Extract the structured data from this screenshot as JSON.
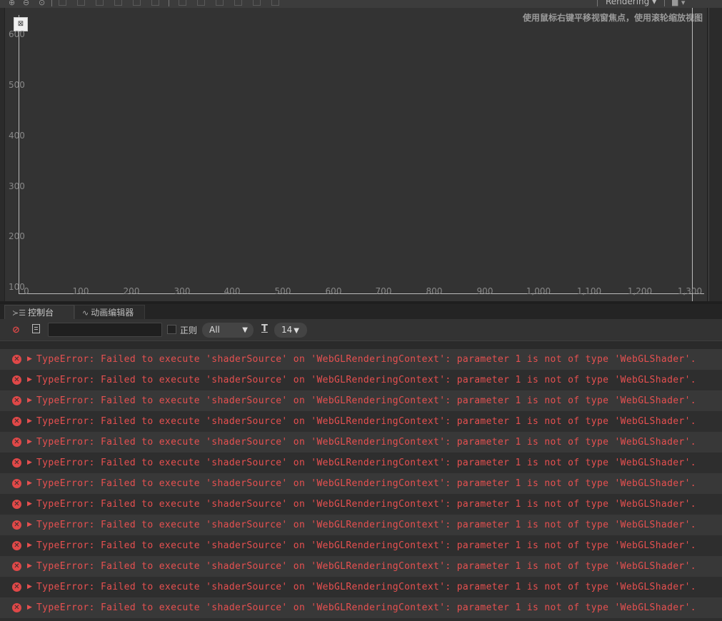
{
  "toolbar": {
    "render_mode": "Rendering",
    "render_mode_arrow": "▾",
    "camera_arrow": "▾",
    "icons": [
      "zoom-in-icon",
      "zoom-out-icon",
      "zoom-fit-icon",
      "align-left-icon",
      "align-center-h-icon",
      "align-right-icon",
      "align-top-icon",
      "align-center-v-icon",
      "align-bottom-icon",
      "distribute-h-icon",
      "distribute-v-icon",
      "camera-icon"
    ]
  },
  "scene": {
    "hint": "使用鼠标右键平移视窗焦点，使用滚轮缩放视图",
    "y_ticks": [
      "600",
      "500",
      "400",
      "300",
      "200",
      "100"
    ],
    "x_ticks": [
      "0",
      "100",
      "200",
      "300",
      "400",
      "500",
      "600",
      "700",
      "800",
      "900",
      "1,000",
      "1,100",
      "1,200",
      "1,300"
    ]
  },
  "tabs": {
    "console": "控制台",
    "animation": "动画编辑器"
  },
  "console_toolbar": {
    "filter_value": "",
    "regex_label": "正则",
    "level": "All",
    "font_size": "14",
    "dropdown_arrow": "▼"
  },
  "log": {
    "rows": [
      "TypeError: Failed to execute 'shaderSource' on 'WebGLRenderingContext': parameter 1 is not of type 'WebGLShader'.",
      "TypeError: Failed to execute 'shaderSource' on 'WebGLRenderingContext': parameter 1 is not of type 'WebGLShader'.",
      "TypeError: Failed to execute 'shaderSource' on 'WebGLRenderingContext': parameter 1 is not of type 'WebGLShader'.",
      "TypeError: Failed to execute 'shaderSource' on 'WebGLRenderingContext': parameter 1 is not of type 'WebGLShader'.",
      "TypeError: Failed to execute 'shaderSource' on 'WebGLRenderingContext': parameter 1 is not of type 'WebGLShader'.",
      "TypeError: Failed to execute 'shaderSource' on 'WebGLRenderingContext': parameter 1 is not of type 'WebGLShader'.",
      "TypeError: Failed to execute 'shaderSource' on 'WebGLRenderingContext': parameter 1 is not of type 'WebGLShader'.",
      "TypeError: Failed to execute 'shaderSource' on 'WebGLRenderingContext': parameter 1 is not of type 'WebGLShader'.",
      "TypeError: Failed to execute 'shaderSource' on 'WebGLRenderingContext': parameter 1 is not of type 'WebGLShader'.",
      "TypeError: Failed to execute 'shaderSource' on 'WebGLRenderingContext': parameter 1 is not of type 'WebGLShader'.",
      "TypeError: Failed to execute 'shaderSource' on 'WebGLRenderingContext': parameter 1 is not of type 'WebGLShader'.",
      "TypeError: Failed to execute 'shaderSource' on 'WebGLRenderingContext': parameter 1 is not of type 'WebGLShader'.",
      "TypeError: Failed to execute 'shaderSource' on 'WebGLRenderingContext': parameter 1 is not of type 'WebGLShader'."
    ],
    "expand_glyph": "▶",
    "error_glyph": "✕"
  },
  "colors": {
    "error": "#e65050",
    "panel_bg": "#333333",
    "console_bg": "#2e2e2e"
  }
}
